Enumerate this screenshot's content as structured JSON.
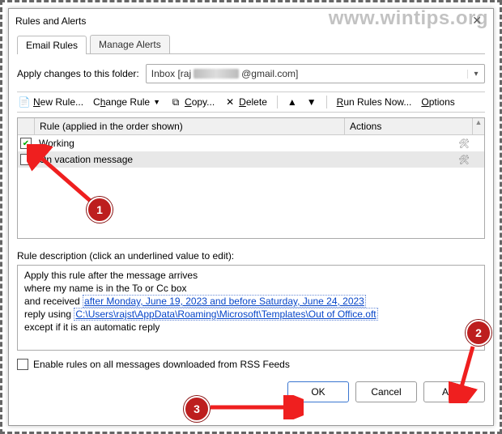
{
  "window": {
    "title": "Rules and Alerts",
    "watermark": "www.wintips.org"
  },
  "tabs": {
    "email_rules": "Email Rules",
    "manage_alerts": "Manage Alerts"
  },
  "folderRow": {
    "label": "Apply changes to this folder:",
    "prefix": "Inbox [raj",
    "suffix": "@gmail.com]"
  },
  "toolbar": {
    "new_rule": "New Rule...",
    "change_rule": "Change Rule",
    "copy": "Copy...",
    "delete": "Delete",
    "run_now": "Run Rules Now...",
    "options": "Options"
  },
  "list": {
    "header_rule": "Rule (applied in the order shown)",
    "header_actions": "Actions",
    "rows": [
      {
        "checked": true,
        "name": "Working"
      },
      {
        "checked": false,
        "name": "On vacation message"
      }
    ]
  },
  "description": {
    "label": "Rule description (click an underlined value to edit):",
    "line1": "Apply this rule after the message arrives",
    "line2": "where my name is in the To or Cc box",
    "line3_prefix": "  and received ",
    "line3_link": "after Monday, June 19, 2023 and before Saturday, June 24, 2023",
    "line4_prefix": "reply using ",
    "line4_link": "C:\\Users\\rajst\\AppData\\Roaming\\Microsoft\\Templates\\Out of Office.oft",
    "line5": "except if it is an automatic reply"
  },
  "rss": {
    "label": "Enable rules on all messages downloaded from RSS Feeds"
  },
  "buttons": {
    "ok": "OK",
    "cancel": "Cancel",
    "apply": "Apply"
  },
  "annotations": {
    "b1": "1",
    "b2": "2",
    "b3": "3"
  }
}
